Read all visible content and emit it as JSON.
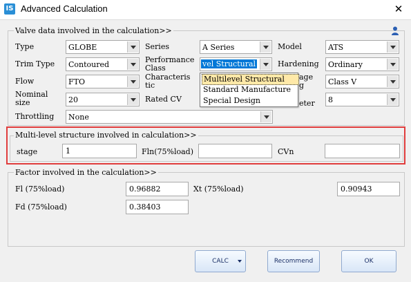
{
  "window": {
    "title": "Advanced Calculation",
    "app_icon_text": "IS",
    "close_glyph": "✕"
  },
  "valve_group": {
    "legend": "Valve data involved in the calculation>>",
    "type": {
      "label": "Type",
      "value": "GLOBE"
    },
    "series": {
      "label": "Series",
      "value": "A Series"
    },
    "model": {
      "label": "Model",
      "value": "ATS"
    },
    "trim_type": {
      "label": "Trim Type",
      "value": "Contoured"
    },
    "performance_class": {
      "label_line1": "Performance",
      "label_line2": "Class",
      "value": "vel Structural"
    },
    "hardening": {
      "label": "Hardening",
      "value": "Ordinary"
    },
    "flow": {
      "label": "Flow",
      "value": "FTO"
    },
    "characteristic": {
      "label_line1": "Characteris",
      "label_line2": "tic",
      "value": ""
    },
    "leakage": {
      "label_line1": "age",
      "label_line2": "g",
      "value": "Class V"
    },
    "nominal_size": {
      "label_line1": "Nominal",
      "label_line2": "size",
      "value": "20"
    },
    "rated_cv": {
      "label": "Rated CV",
      "value": ""
    },
    "diameter": {
      "label": "eter",
      "value": "8"
    },
    "throttling": {
      "label": "Throttling",
      "value": "None"
    }
  },
  "performance_dropdown": {
    "options": [
      "Multilevel Structural",
      "Standard Manufacture",
      "Special Design"
    ],
    "highlighted": "Multilevel Structural"
  },
  "multilevel_group": {
    "legend": "Multi-level structure involved in calculation>>",
    "stage": {
      "label": "stage",
      "value": "1"
    },
    "fln": {
      "label": "Fln(75%load)",
      "value": ""
    },
    "cvn": {
      "label": "CVn",
      "value": ""
    }
  },
  "factor_group": {
    "legend": "Factor  involved in the calculation>>",
    "fl": {
      "label": "Fl (75%load)",
      "value": "0.96882"
    },
    "xt": {
      "label": "Xt (75%load)",
      "value": "0.90943"
    },
    "fd": {
      "label": "Fd (75%load)",
      "value": "0.38403"
    }
  },
  "buttons": {
    "calc": "CALC",
    "recommend": "Recommend",
    "ok": "OK"
  },
  "colors": {
    "highlight_border": "#e03c3c",
    "selection": "#0078d7",
    "dropdown_hover": "#ffe9a8",
    "app_icon": "#2a8fd6"
  },
  "icons": {
    "app": "app-icon",
    "close": "close-icon",
    "toolbar": "person-icon"
  }
}
